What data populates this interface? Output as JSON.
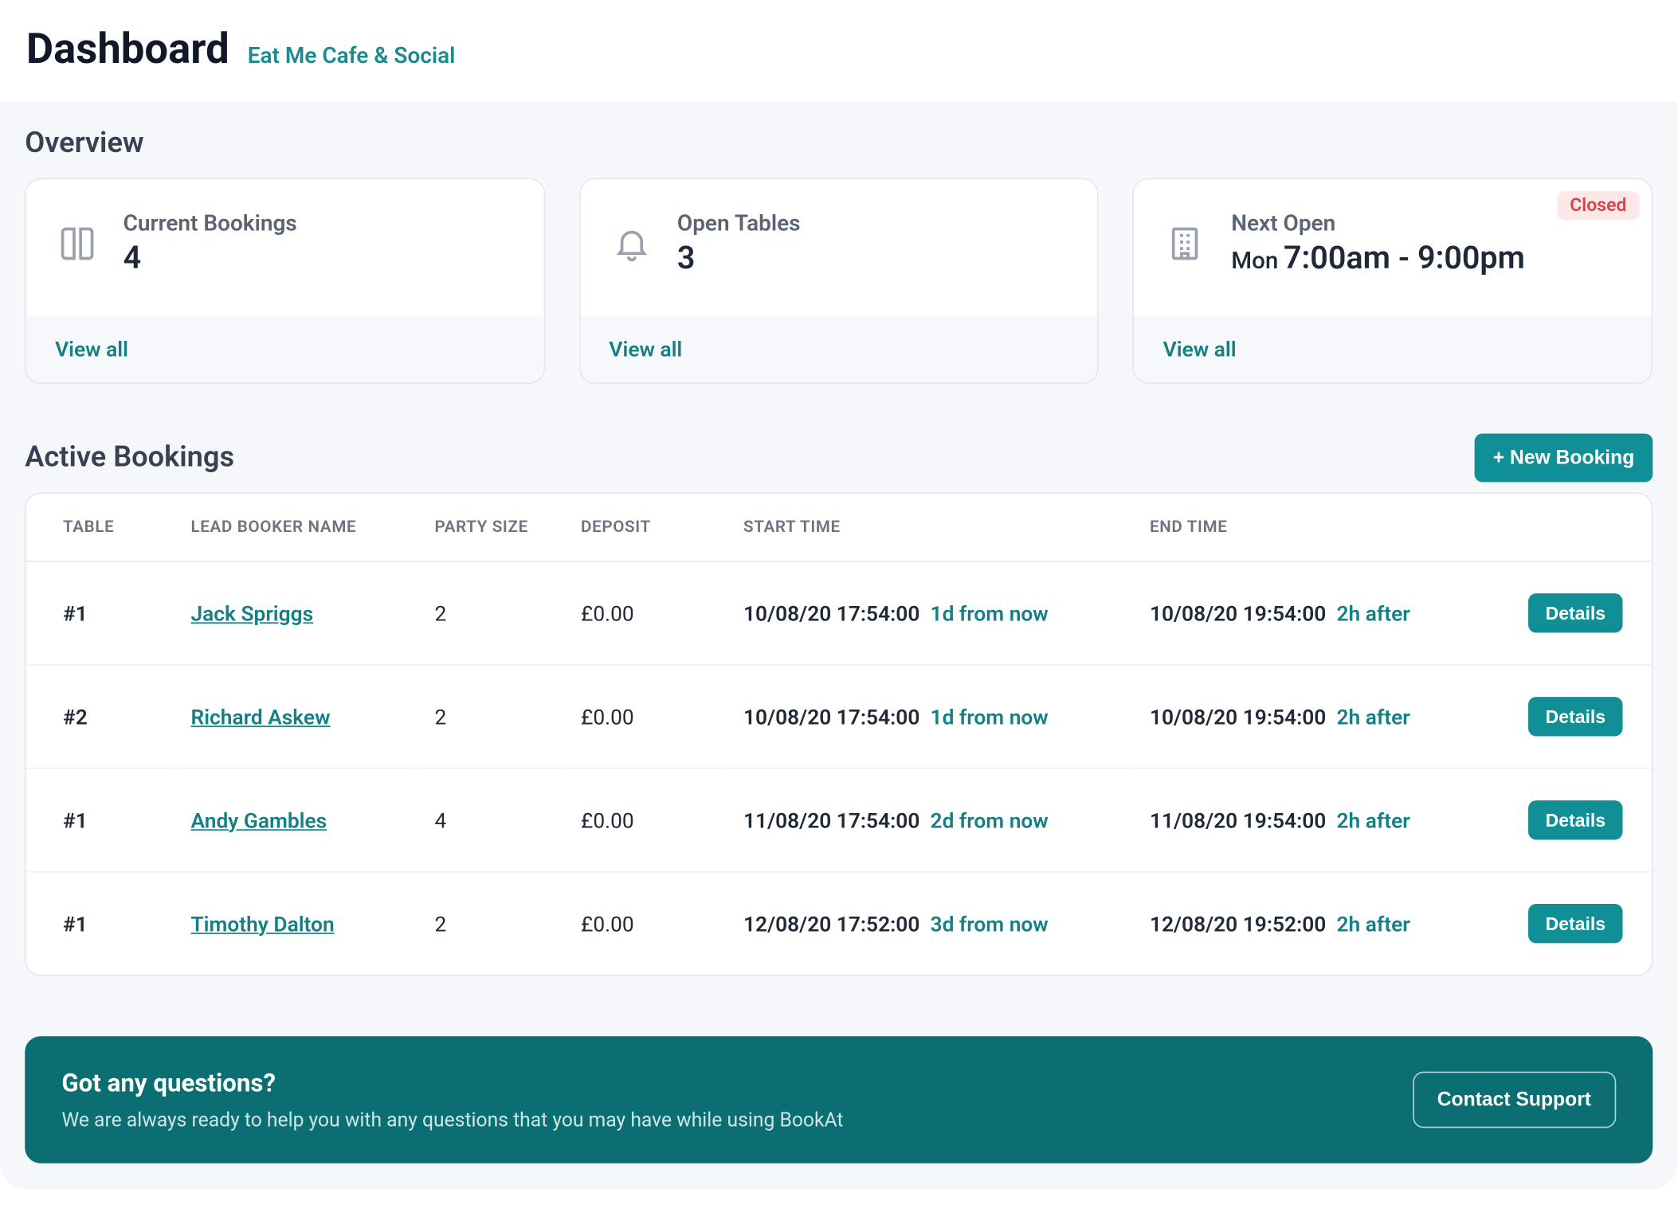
{
  "header": {
    "title": "Dashboard",
    "subtitle": "Eat Me Cafe & Social"
  },
  "overview": {
    "title": "Overview",
    "cards": [
      {
        "label": "Current Bookings",
        "value": "4",
        "link_label": "View all",
        "icon": "book"
      },
      {
        "label": "Open Tables",
        "value": "3",
        "link_label": "View all",
        "icon": "bell"
      },
      {
        "label": "Next Open",
        "day": "Mon",
        "value": "7:00am - 9:00pm",
        "link_label": "View all",
        "icon": "building",
        "badge": "Closed"
      }
    ]
  },
  "active_bookings": {
    "title": "Active Bookings",
    "new_button": "+ New Booking",
    "columns": {
      "table": "TABLE",
      "lead_booker": "LEAD BOOKER NAME",
      "party_size": "PARTY SIZE",
      "deposit": "DEPOSIT",
      "start_time": "START TIME",
      "end_time": "END TIME"
    },
    "details_label": "Details",
    "rows": [
      {
        "table": "#1",
        "lead_booker": "Jack Spriggs",
        "party_size": "2",
        "deposit": "£0.00",
        "start": "10/08/20 17:54:00",
        "start_rel": "1d from now",
        "end": "10/08/20 19:54:00",
        "end_rel": "2h after"
      },
      {
        "table": "#2",
        "lead_booker": "Richard Askew",
        "party_size": "2",
        "deposit": "£0.00",
        "start": "10/08/20 17:54:00",
        "start_rel": "1d from now",
        "end": "10/08/20 19:54:00",
        "end_rel": "2h after"
      },
      {
        "table": "#1",
        "lead_booker": "Andy Gambles",
        "party_size": "4",
        "deposit": "£0.00",
        "start": "11/08/20 17:54:00",
        "start_rel": "2d from now",
        "end": "11/08/20 19:54:00",
        "end_rel": "2h after"
      },
      {
        "table": "#1",
        "lead_booker": "Timothy Dalton",
        "party_size": "2",
        "deposit": "£0.00",
        "start": "12/08/20 17:52:00",
        "start_rel": "3d from now",
        "end": "12/08/20 19:52:00",
        "end_rel": "2h after"
      }
    ]
  },
  "support": {
    "title": "Got any questions?",
    "subtitle": "We are always ready to help you with any questions that you may have while using BookAt",
    "button": "Contact Support"
  }
}
